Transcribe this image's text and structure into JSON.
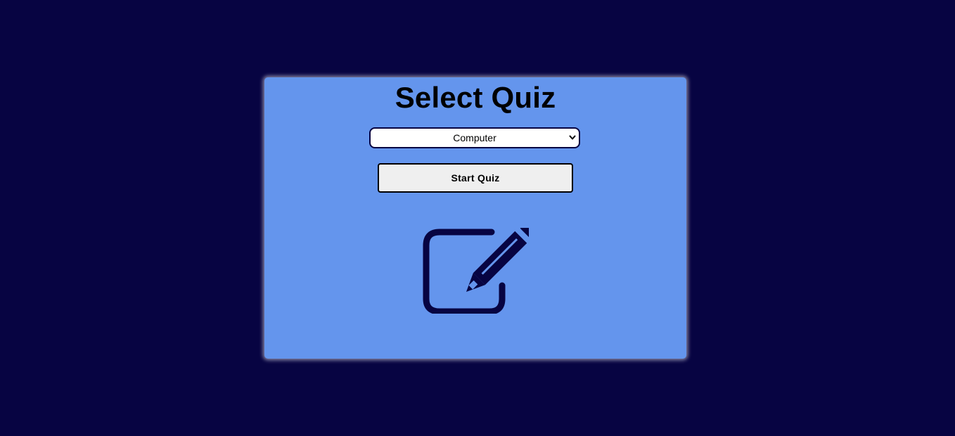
{
  "page": {
    "title": "Select Quiz"
  },
  "quiz_select": {
    "selected": "Computer",
    "options": [
      "Computer"
    ]
  },
  "start_button": {
    "label": "Start Quiz"
  },
  "icons": {
    "dropdown": "chevron-down-icon",
    "illustration": "edit-icon"
  },
  "colors": {
    "background": "#070442",
    "card": "#6495ED",
    "icon": "#070442",
    "button": "#efefef"
  }
}
